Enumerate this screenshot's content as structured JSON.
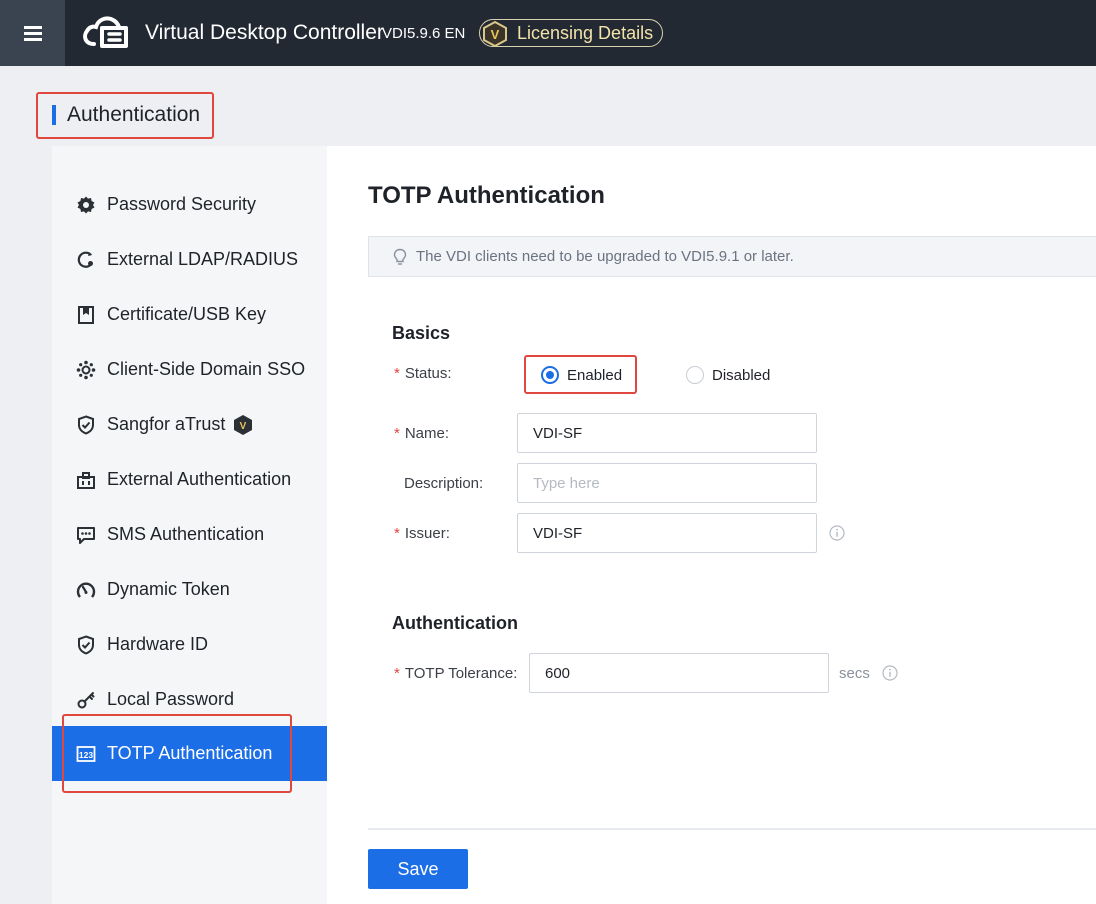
{
  "topbar": {
    "app_title": "Virtual Desktop Controller",
    "version": "VDI5.9.6 EN",
    "licensing_label": "Licensing Details",
    "badge_letter": "V",
    "colors": {
      "background": "#232933",
      "menu_button": "#3a4350",
      "licensing_text": "#f3e3a8"
    }
  },
  "breadcrumb": {
    "title": "Authentication"
  },
  "sidebar": {
    "items": [
      {
        "label": "Password Security",
        "icon": "gear-icon",
        "active": false
      },
      {
        "label": "External LDAP/RADIUS",
        "icon": "ldap-icon",
        "active": false
      },
      {
        "label": "Certificate/USB Key",
        "icon": "certificate-icon",
        "active": false
      },
      {
        "label": "Client-Side Domain SSO",
        "icon": "domain-sso-icon",
        "active": false
      },
      {
        "label": "Sangfor aTrust",
        "icon": "shield-icon",
        "active": false,
        "badge": "V"
      },
      {
        "label": "External Authentication",
        "icon": "external-auth-icon",
        "active": false
      },
      {
        "label": "SMS Authentication",
        "icon": "sms-icon",
        "active": false
      },
      {
        "label": "Dynamic Token",
        "icon": "token-icon",
        "active": false
      },
      {
        "label": "Hardware ID",
        "icon": "shield-check-icon",
        "active": false
      },
      {
        "label": "Local Password",
        "icon": "key-icon",
        "active": false
      },
      {
        "label": "TOTP Authentication",
        "icon": "totp-icon",
        "active": true
      }
    ],
    "colors": {
      "active_background": "#1b6ee6"
    }
  },
  "main": {
    "title": "TOTP Authentication",
    "notice": {
      "icon": "lightbulb-icon",
      "text": "The VDI clients need to be upgraded to VDI5.9.1 or later."
    },
    "basics": {
      "title": "Basics",
      "status": {
        "label": "Status:",
        "options": [
          "Enabled",
          "Disabled"
        ],
        "selected": "Enabled"
      },
      "name": {
        "label": "Name:",
        "value": "VDI-SF"
      },
      "description": {
        "label": "Description:",
        "value": "",
        "placeholder": "Type here"
      },
      "issuer": {
        "label": "Issuer:",
        "value": "VDI-SF"
      }
    },
    "authentication": {
      "title": "Authentication",
      "totp_tolerance": {
        "label": "TOTP Tolerance:",
        "value": "600",
        "unit": "secs"
      }
    },
    "save_label": "Save",
    "required_mark": "*"
  },
  "colors": {
    "accent": "#1b6ee6",
    "highlight_box": "#e0473e",
    "required": "#e0473e"
  }
}
